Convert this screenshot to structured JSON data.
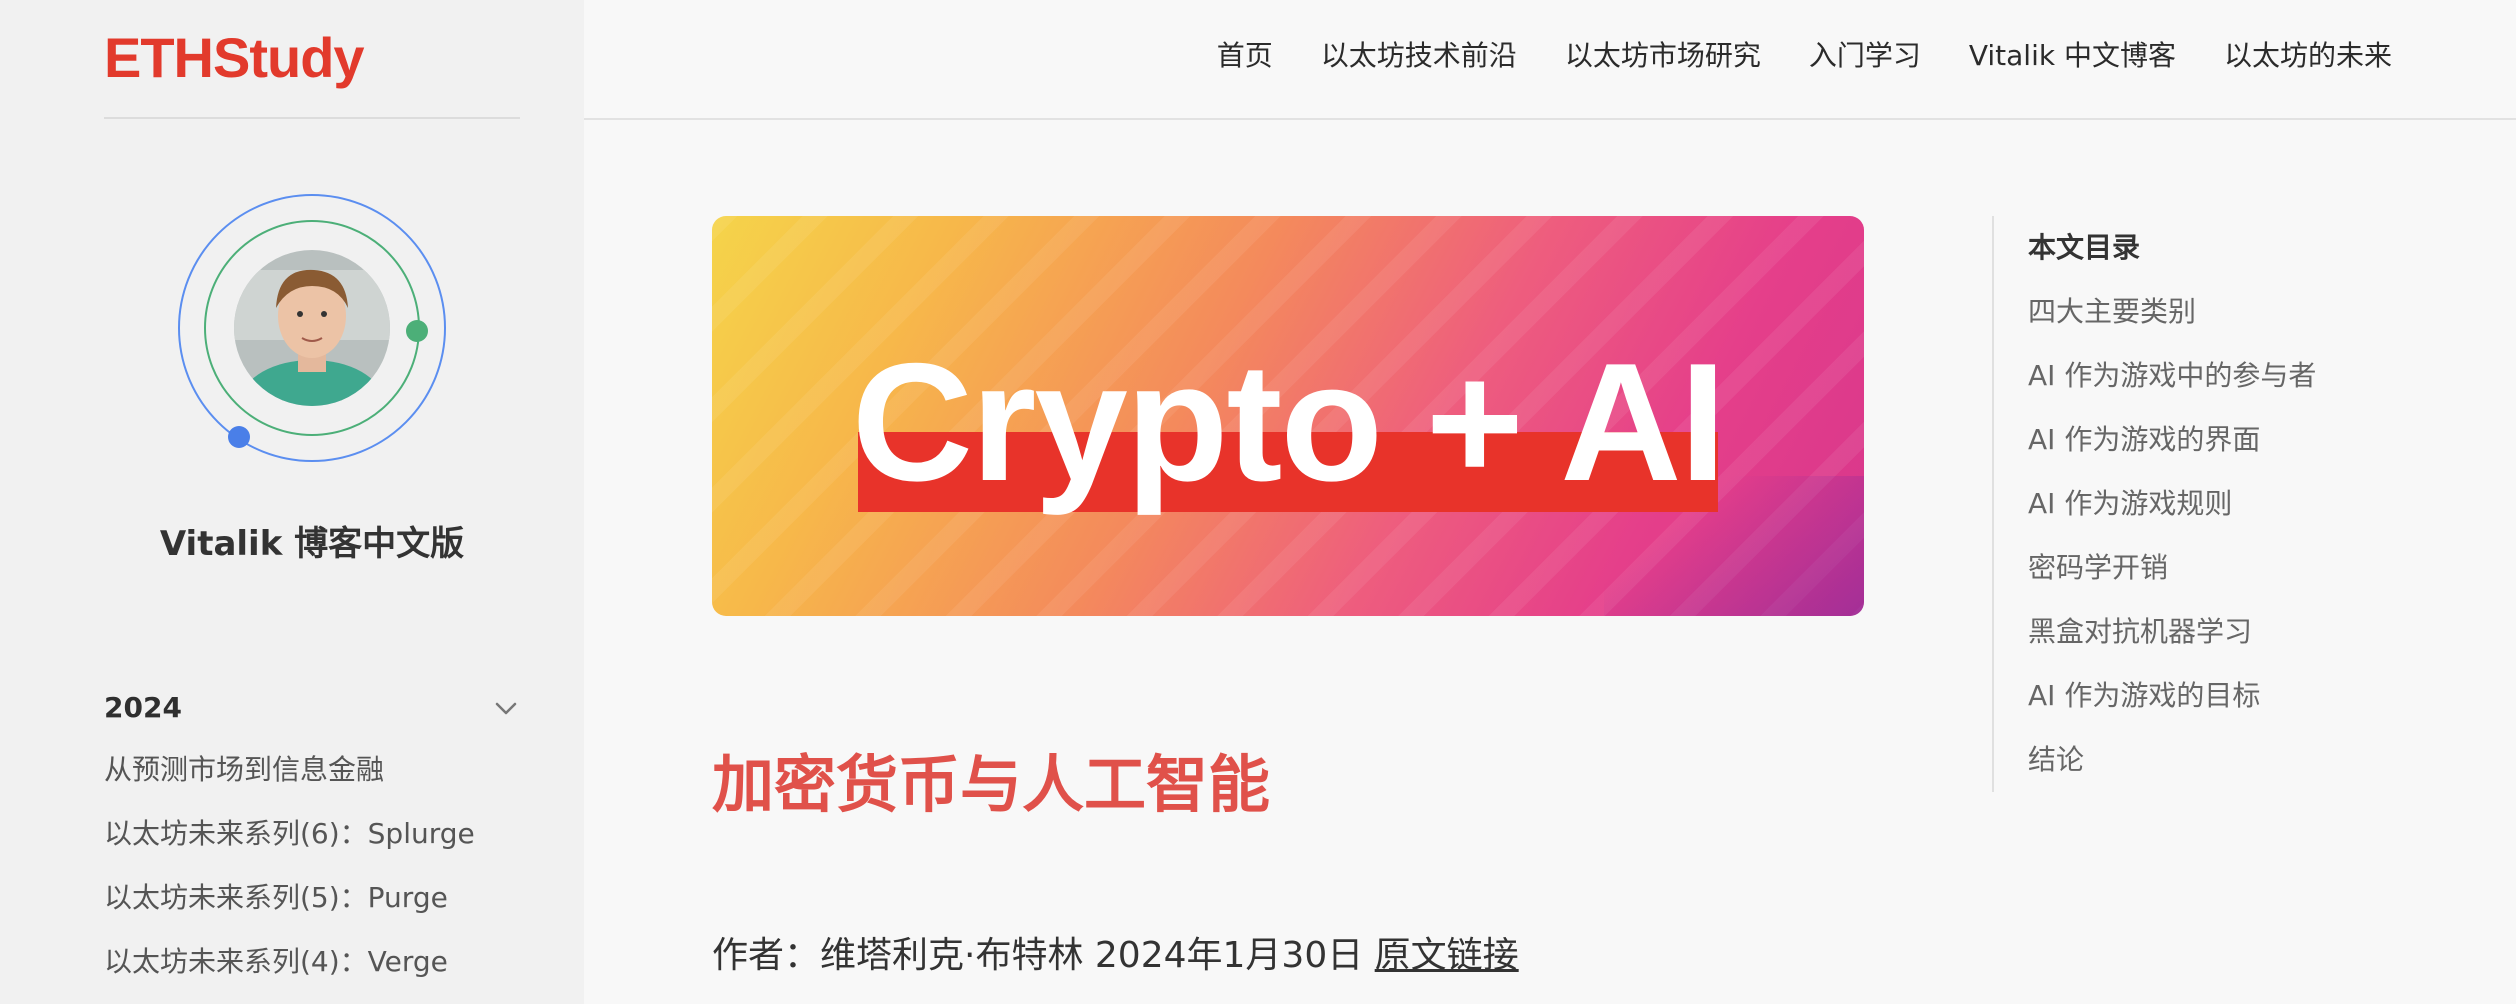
{
  "site": {
    "logo": "ETHStudy"
  },
  "nav": {
    "items": [
      {
        "label": "首页"
      },
      {
        "label": "以太坊技术前沿"
      },
      {
        "label": "以太坊市场研究"
      },
      {
        "label": "入门学习"
      },
      {
        "label": "Vitalik 中文博客"
      },
      {
        "label": "以太坊的未来"
      }
    ]
  },
  "sidebar": {
    "author_name": "Vitalik 博客中文版",
    "year": "2024",
    "chevron_icon": "chevron-down-icon",
    "posts": [
      {
        "label": "从预测市场到信息金融"
      },
      {
        "label": "以太坊未来系列(6)：Splurge"
      },
      {
        "label": "以太坊未来系列(5)：Purge"
      },
      {
        "label": "以太坊未来系列(4)：Verge"
      }
    ]
  },
  "hero": {
    "text": "Crypto + AI"
  },
  "article": {
    "title": "加密货币与人工智能",
    "byline_prefix": "作者：维塔利克·布特林 2024年1月30日",
    "source_link": "原文链接"
  },
  "toc": {
    "title": "本文目录",
    "items": [
      {
        "label": "四大主要类别"
      },
      {
        "label": "AI 作为游戏中的参与者"
      },
      {
        "label": "AI 作为游戏的界面"
      },
      {
        "label": "AI 作为游戏规则"
      },
      {
        "label": "密码学开销"
      },
      {
        "label": "黑盒对抗机器学习"
      },
      {
        "label": "AI 作为游戏的目标"
      },
      {
        "label": "结论"
      }
    ]
  },
  "colors": {
    "brand": "#e23a2c",
    "title": "#e0514a",
    "ring_outer": "#5b8ef0",
    "ring_inner": "#4caf78"
  }
}
